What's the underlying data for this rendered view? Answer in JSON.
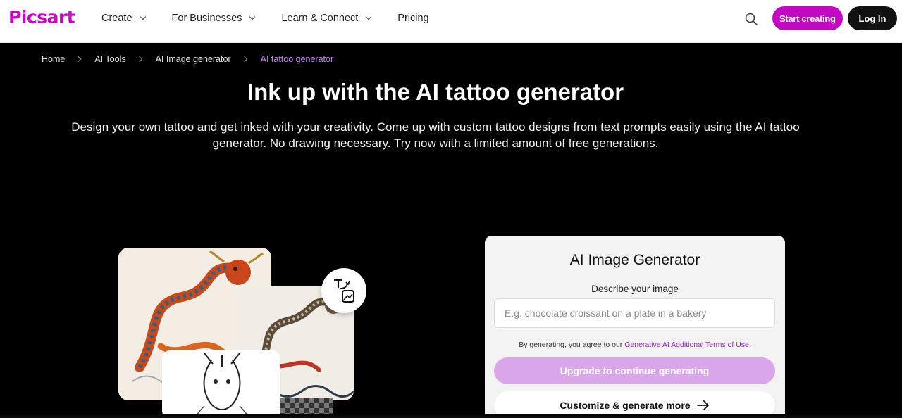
{
  "header": {
    "logo": "Picsart",
    "nav": [
      {
        "label": "Create",
        "has_dropdown": true
      },
      {
        "label": "For Businesses",
        "has_dropdown": true
      },
      {
        "label": "Learn & Connect",
        "has_dropdown": true
      },
      {
        "label": "Pricing",
        "has_dropdown": false
      }
    ],
    "search_icon": "search-icon",
    "start_label": "Start creating",
    "login_label": "Log In"
  },
  "breadcrumb": [
    "Home",
    "AI Tools",
    "AI Image generator",
    "AI tattoo generator"
  ],
  "hero": {
    "title": "Ink up with the AI tattoo generator",
    "subtitle": "Design your own tattoo and get inked with your creativity. Come up with custom tattoo designs from text prompts easily using the AI tattoo generator. No drawing necessary. Try now with a limited amount of free generations."
  },
  "generator": {
    "title": "AI Image Generator",
    "label": "Describe your image",
    "placeholder": "E.g. chocolate croissant on a plate in a bakery",
    "terms_prefix": "By generating, you agree to our ",
    "terms_link": "Generative AI Additional Terms of Use.",
    "upgrade_label": "Upgrade to continue generating",
    "customize_label": "Customize & generate more"
  },
  "colors": {
    "brand": "#c209c1",
    "upgrade_button": "#d9a6ea",
    "active_crumb": "#c98af5"
  },
  "icons": [
    "search-icon",
    "chevron-down-icon",
    "chevron-right-icon",
    "text-to-image-icon",
    "arrow-right-icon"
  ]
}
